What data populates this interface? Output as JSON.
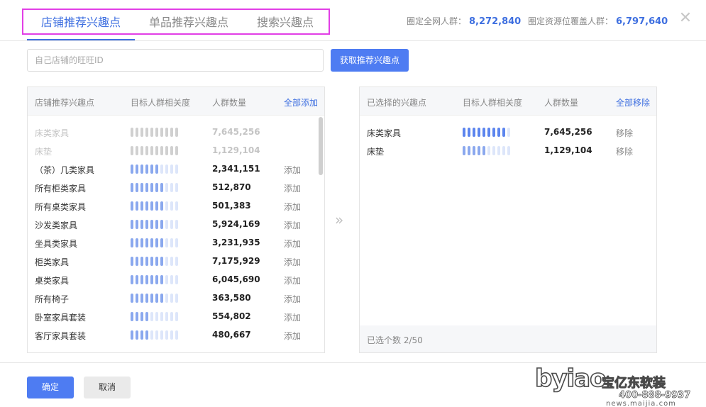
{
  "tabs": [
    {
      "label": "店铺推荐兴趣点",
      "active": true
    },
    {
      "label": "单品推荐兴趣点",
      "active": false
    },
    {
      "label": "搜索兴趣点",
      "active": false
    }
  ],
  "stats": {
    "network_label": "圈定全网人群：",
    "network_value": "8,272,840",
    "coverage_label": "圈定资源位覆盖人群：",
    "coverage_value": "6,797,640"
  },
  "close_glyph": "✕",
  "search": {
    "placeholder": "自己店铺的旺旺ID",
    "button_label": "获取推荐兴趣点"
  },
  "left_panel": {
    "headers": {
      "name": "店铺推荐兴趣点",
      "relevance": "目标人群相关度",
      "count": "人群数量",
      "action": "全部添加"
    },
    "rows": [
      {
        "name": "床类家具",
        "relevance": 9,
        "count": "7,645,256",
        "action": "",
        "disabled": true
      },
      {
        "name": "床垫",
        "relevance": 5,
        "count": "1,129,104",
        "action": "",
        "disabled": true
      },
      {
        "name": "（茶）几类家具",
        "relevance": 6,
        "count": "2,341,151",
        "action": "添加",
        "disabled": false
      },
      {
        "name": "所有柜类家具",
        "relevance": 7,
        "count": "512,870",
        "action": "添加",
        "disabled": false
      },
      {
        "name": "所有桌类家具",
        "relevance": 7,
        "count": "501,383",
        "action": "添加",
        "disabled": false
      },
      {
        "name": "沙发类家具",
        "relevance": 7,
        "count": "5,924,169",
        "action": "添加",
        "disabled": false
      },
      {
        "name": "坐具类家具",
        "relevance": 7,
        "count": "3,231,935",
        "action": "添加",
        "disabled": false
      },
      {
        "name": "柜类家具",
        "relevance": 7,
        "count": "7,175,929",
        "action": "添加",
        "disabled": false
      },
      {
        "name": "桌类家具",
        "relevance": 7,
        "count": "6,045,690",
        "action": "添加",
        "disabled": false
      },
      {
        "name": "所有椅子",
        "relevance": 7,
        "count": "363,580",
        "action": "添加",
        "disabled": false
      },
      {
        "name": "卧室家具套装",
        "relevance": 4,
        "count": "554,802",
        "action": "添加",
        "disabled": false
      },
      {
        "name": "客厅家具套装",
        "relevance": 4,
        "count": "480,667",
        "action": "添加",
        "disabled": false
      }
    ]
  },
  "right_panel": {
    "headers": {
      "name": "已选择的兴趣点",
      "relevance": "目标人群相关度",
      "count": "人群数量",
      "action": "全部移除"
    },
    "rows": [
      {
        "name": "床类家具",
        "relevance": 9,
        "count": "7,645,256",
        "action": "移除"
      },
      {
        "name": "床垫",
        "relevance": 5,
        "count": "1,129,104",
        "action": "移除"
      }
    ],
    "footer": "已选个数 2/50"
  },
  "bar_total": 10,
  "arrow_glyph": "»",
  "footer": {
    "ok_label": "确定",
    "cancel_label": "取消"
  },
  "watermark": {
    "logo": "byiao",
    "brand": "宝亿东软装",
    "phone": "400-888-9937",
    "url": "news.maijia.com"
  },
  "colors": {
    "accent": "#3e6fe0",
    "highlight_box": "#e23fe6"
  }
}
